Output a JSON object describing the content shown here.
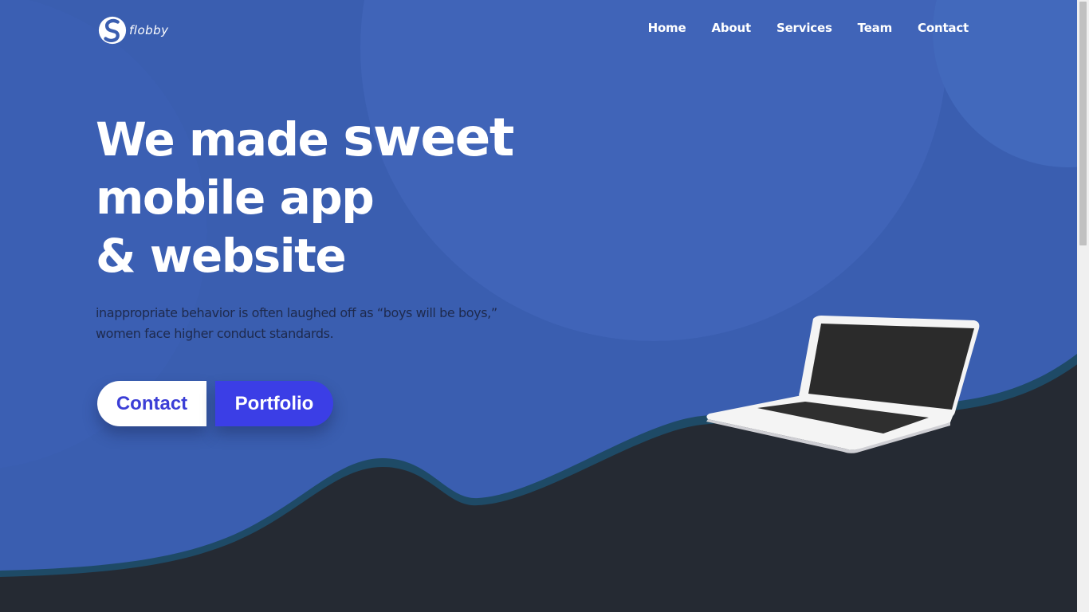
{
  "brand": {
    "name": "flobby",
    "logo_icon": "s-swirl-logo-icon"
  },
  "nav": {
    "items": [
      "Home",
      "About",
      "Services",
      "Team",
      "Contact"
    ]
  },
  "hero": {
    "title_line1_a": "We made ",
    "title_line1_b": "sweet",
    "title_line2": "mobile app",
    "title_line3": "& website",
    "subtitle": "inappropriate behavior is often laughed off as “boys will be boys,” women face higher conduct standards."
  },
  "buttons": {
    "contact": "Contact",
    "portfolio": "Portfolio"
  },
  "illustration": {
    "icon": "laptop-icon"
  },
  "colors": {
    "background": "#3a5eb0",
    "circle": "#4064b8",
    "ground": "#252a33",
    "wave_edge": "#1e4a66",
    "accent": "#3b3ee6",
    "text": "#ffffff"
  }
}
